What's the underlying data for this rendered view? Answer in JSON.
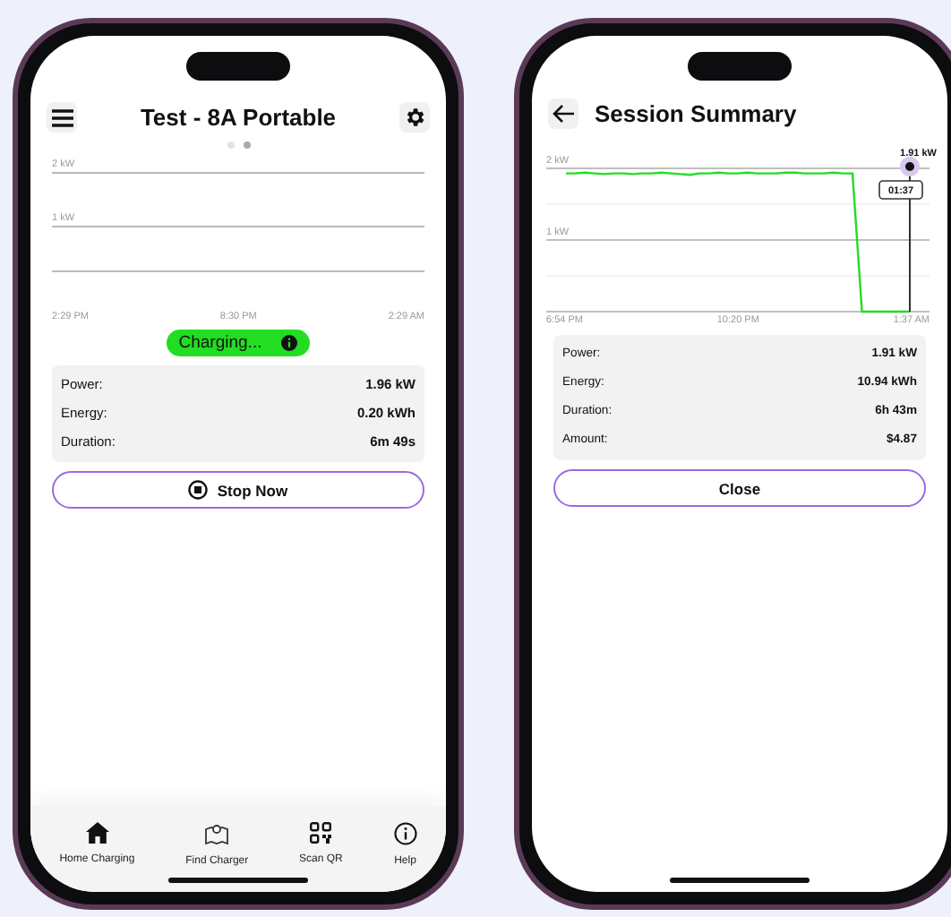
{
  "live_screen": {
    "title": "Test - 8A Portable",
    "page_dots": [
      {
        "selected": false
      },
      {
        "selected": true
      }
    ],
    "chart": {
      "y_labels": [
        "2 kW",
        "1 kW"
      ],
      "x_labels": [
        "2:29 PM",
        "8:30 PM",
        "2:29 AM"
      ]
    },
    "status": "Charging...",
    "stats": [
      {
        "label": "Power:",
        "value": "1.96 kW"
      },
      {
        "label": "Energy:",
        "value": "0.20 kWh"
      },
      {
        "label": "Duration:",
        "value": "6m 49s"
      }
    ],
    "action_button": "Stop Now",
    "tab_bar": [
      {
        "kind": "home",
        "label": "Home Charging"
      },
      {
        "kind": "map",
        "label": "Find Charger"
      },
      {
        "kind": "qr",
        "label": "Scan QR"
      },
      {
        "kind": "info",
        "label": "Help"
      }
    ]
  },
  "summary_screen": {
    "title": "Session Summary",
    "chart_data": {
      "type": "line",
      "ylim": [
        0,
        2.3
      ],
      "ref_lines": [
        {
          "axis": "y",
          "value": 0.5
        },
        {
          "axis": "y",
          "value": 1.5
        }
      ],
      "categories": [
        "6:54 PM",
        null,
        null,
        null,
        null,
        null,
        null,
        null,
        null,
        null,
        null,
        null,
        null,
        null,
        null,
        null,
        null,
        null,
        "10:20 PM",
        null,
        null,
        null,
        null,
        null,
        null,
        null,
        null,
        null,
        null,
        null,
        null,
        null,
        null,
        null,
        null,
        null,
        "1:37 AM"
      ],
      "yticks": [
        {
          "value": 1,
          "label": "1 kW"
        },
        {
          "value": 2,
          "label": "2 kW"
        }
      ],
      "series": [
        {
          "color": "#22dd22",
          "values": [
            1.93,
            1.93,
            1.94,
            1.93,
            1.92,
            1.93,
            1.93,
            1.92,
            1.93,
            1.93,
            1.94,
            1.93,
            1.92,
            1.91,
            1.93,
            1.93,
            1.94,
            1.93,
            1.93,
            1.94,
            1.93,
            1.93,
            1.93,
            1.94,
            1.94,
            1.93,
            1.93,
            1.93,
            1.94,
            1.93,
            1.93,
            0,
            0,
            0,
            0,
            0,
            0
          ]
        }
      ]
    },
    "cursor_value": "1.91 kW",
    "cursor_time": "01:37",
    "stats": [
      {
        "label": "Power:",
        "value": "1.91 kW"
      },
      {
        "label": "Energy:",
        "value": "10.94 kWh"
      },
      {
        "label": "Duration:",
        "value": "6h 43m"
      },
      {
        "label": "Amount:",
        "value": "$4.87"
      }
    ],
    "action_button": "Close"
  }
}
